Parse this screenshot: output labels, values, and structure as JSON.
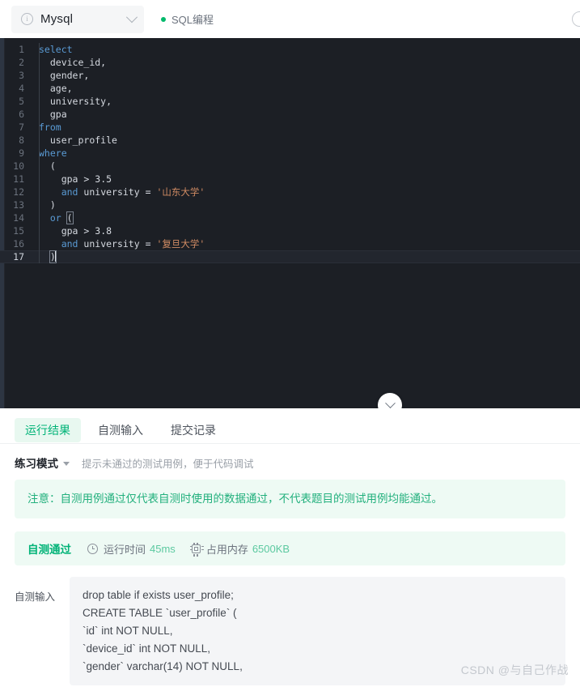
{
  "header": {
    "language": "Mysql",
    "info_icon": "info-circle-icon",
    "chevron_icon": "chevron-down-icon",
    "topic_label": "SQL编程",
    "topic_dot_color": "#00b96b",
    "right_icon": "circle-icon"
  },
  "editor": {
    "background": "#1c1f25",
    "lines": [
      {
        "n": "1",
        "tokens": [
          {
            "t": "select",
            "c": "kw"
          }
        ]
      },
      {
        "n": "2",
        "tokens": [
          {
            "t": "  ",
            "c": "punc"
          },
          {
            "t": "device_id",
            "c": "id"
          },
          {
            "t": ",",
            "c": "punc"
          }
        ]
      },
      {
        "n": "3",
        "tokens": [
          {
            "t": "  ",
            "c": "punc"
          },
          {
            "t": "gender",
            "c": "id"
          },
          {
            "t": ",",
            "c": "punc"
          }
        ]
      },
      {
        "n": "4",
        "tokens": [
          {
            "t": "  ",
            "c": "punc"
          },
          {
            "t": "age",
            "c": "id"
          },
          {
            "t": ",",
            "c": "punc"
          }
        ]
      },
      {
        "n": "5",
        "tokens": [
          {
            "t": "  ",
            "c": "punc"
          },
          {
            "t": "university",
            "c": "id"
          },
          {
            "t": ",",
            "c": "punc"
          }
        ]
      },
      {
        "n": "6",
        "tokens": [
          {
            "t": "  ",
            "c": "punc"
          },
          {
            "t": "gpa",
            "c": "id"
          }
        ]
      },
      {
        "n": "7",
        "tokens": [
          {
            "t": "from",
            "c": "kw"
          }
        ]
      },
      {
        "n": "8",
        "tokens": [
          {
            "t": "  ",
            "c": "punc"
          },
          {
            "t": "user_profile",
            "c": "id"
          }
        ]
      },
      {
        "n": "9",
        "tokens": [
          {
            "t": "where",
            "c": "kw"
          }
        ]
      },
      {
        "n": "10",
        "tokens": [
          {
            "t": "  ",
            "c": "punc"
          },
          {
            "t": "(",
            "c": "punc"
          }
        ]
      },
      {
        "n": "11",
        "tokens": [
          {
            "t": "    ",
            "c": "punc"
          },
          {
            "t": "gpa",
            "c": "id"
          },
          {
            "t": " > ",
            "c": "op"
          },
          {
            "t": "3.5",
            "c": "num"
          }
        ]
      },
      {
        "n": "12",
        "tokens": [
          {
            "t": "    ",
            "c": "punc"
          },
          {
            "t": "and",
            "c": "kw"
          },
          {
            "t": " ",
            "c": "punc"
          },
          {
            "t": "university",
            "c": "id"
          },
          {
            "t": " = ",
            "c": "op"
          },
          {
            "t": "'山东大学'",
            "c": "str"
          }
        ]
      },
      {
        "n": "13",
        "tokens": [
          {
            "t": "  ",
            "c": "punc"
          },
          {
            "t": ")",
            "c": "punc"
          }
        ]
      },
      {
        "n": "14",
        "tokens": [
          {
            "t": "  ",
            "c": "punc"
          },
          {
            "t": "or",
            "c": "kw"
          },
          {
            "t": " ",
            "c": "punc"
          },
          {
            "t": "(",
            "c": "punc",
            "brk": true
          }
        ]
      },
      {
        "n": "15",
        "tokens": [
          {
            "t": "    ",
            "c": "punc"
          },
          {
            "t": "gpa",
            "c": "id"
          },
          {
            "t": " > ",
            "c": "op"
          },
          {
            "t": "3.8",
            "c": "num"
          }
        ]
      },
      {
        "n": "16",
        "tokens": [
          {
            "t": "    ",
            "c": "punc"
          },
          {
            "t": "and",
            "c": "kw"
          },
          {
            "t": " ",
            "c": "punc"
          },
          {
            "t": "university",
            "c": "id"
          },
          {
            "t": " = ",
            "c": "op"
          },
          {
            "t": "'复旦大学'",
            "c": "str"
          }
        ]
      },
      {
        "n": "17",
        "tokens": [
          {
            "t": "  ",
            "c": "punc"
          },
          {
            "t": ")",
            "c": "punc",
            "brk": true
          }
        ],
        "active": true,
        "caret": true
      }
    ],
    "collapse_icon": "chevron-down-icon"
  },
  "panel": {
    "tabs": [
      {
        "label": "运行结果",
        "active": true
      },
      {
        "label": "自测输入",
        "active": false
      },
      {
        "label": "提交记录",
        "active": false
      }
    ],
    "mode": {
      "name": "练习模式",
      "caret_icon": "caret-down-icon",
      "hint": "提示未通过的测试用例，便于代码调试"
    },
    "notice": "注意：自测用例通过仅代表自测时使用的数据通过，不代表题目的测试用例均能通过。",
    "status": {
      "result": "自测通过",
      "time_icon": "clock-icon",
      "time_label": "运行时间",
      "time_value": "45ms",
      "memory_icon": "chip-icon",
      "memory_label": "占用内存",
      "memory_value": "6500KB",
      "accent_color": "#00b377"
    },
    "self_test": {
      "label": "自测输入",
      "content": "drop table if exists user_profile;\nCREATE TABLE `user_profile` (\n`id` int NOT NULL,\n`device_id` int NOT NULL,\n`gender` varchar(14) NOT NULL,"
    }
  },
  "watermark": "CSDN @与自己作战"
}
